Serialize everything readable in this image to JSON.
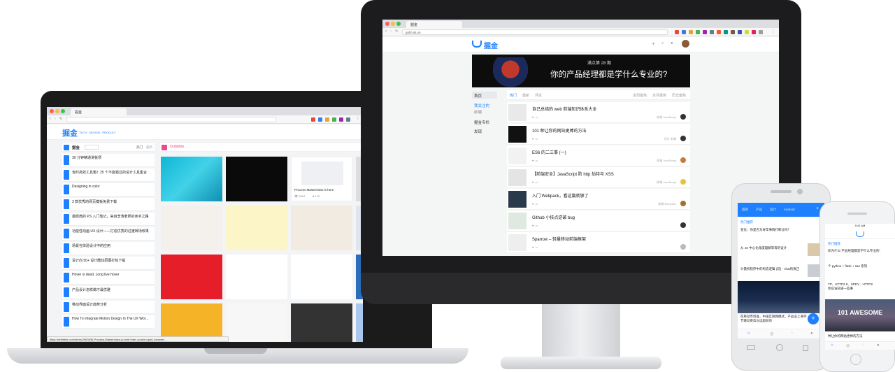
{
  "colors": {
    "accent": "#1e80ff",
    "dribbble": "#ea4c89",
    "dark": "#1c1c1e"
  },
  "laptop": {
    "tab_title": "掘金",
    "url": "",
    "status_bar_url": "https://dribbble.com/shots/2963836-Process-Masterclass-is-here?utm_source=gold_browser...",
    "brand": "掘金",
    "tagline": "TECH · DESIGN · PRODUCT",
    "left_panel": {
      "title": "掘金",
      "filter": "",
      "tabs": [
        "热门",
        "最新"
      ],
      "items": [
        {
          "title": "30 分钟精通滑板项",
          "meta": ""
        },
        {
          "title": "省时高效工具箱！25 个不能错过的设计工具集合",
          "meta": ""
        },
        {
          "title": "Designing in color",
          "meta": ""
        },
        {
          "title": "3 款优秀的网页模板免费下载",
          "meta": ""
        },
        {
          "title": "最经典的 PS 入门笔记，来自李涛老师的亲手之路",
          "meta": ""
        },
        {
          "title": "功能性动画 UX 设计——打造优秀的过渡转场效果",
          "meta": ""
        },
        {
          "title": "场景在体验设计中的应用",
          "meta": ""
        },
        {
          "title": "设计向 50+ 设计酷炫原图打包下载",
          "meta": ""
        },
        {
          "title": "Hover is dead. Long live hover",
          "meta": ""
        },
        {
          "title": "产品设计怎样做才最优雅",
          "meta": ""
        },
        {
          "title": "移动界面设计趋势分析",
          "meta": ""
        },
        {
          "title": "How To Integrate Motion Design In The UX Wor...",
          "meta": ""
        }
      ]
    },
    "right_panel": {
      "title": "Dribbble",
      "shot_title": "Process Masterclass is here",
      "shot_views": "2534",
      "shot_likes": "175"
    }
  },
  "monitor": {
    "url": "gold.xitu.io",
    "brand": "掘金",
    "banner": {
      "small": "满点第 28 期",
      "headline": "你的产品经理都是学什么专业的?"
    },
    "sidebar": [
      "首页",
      "我关注的",
      "前端",
      "掘金专栏",
      "发现"
    ],
    "feed_tabs": [
      "热门",
      "最新",
      "评论"
    ],
    "feed_tabs_right": [
      "本周最热",
      "本月最热",
      "历史最热"
    ],
    "articles": [
      {
        "title": "自己总结的 web 前端知识体系大全",
        "time": "",
        "likes": "",
        "comments": "",
        "tags": "前端  JavaScript"
      },
      {
        "title": "101 种让你的网站更棒的方法",
        "time": "",
        "likes": "",
        "comments": "",
        "tags": "设计  前端"
      },
      {
        "title": "ES6 的二三事 (一)",
        "time": "",
        "likes": "",
        "comments": "",
        "tags": "前端  JavaScript"
      },
      {
        "title": "【前端安全】JavaScript 防 http 劫持与 XSS",
        "time": "",
        "likes": "",
        "comments": "",
        "tags": "前端  JavaScript"
      },
      {
        "title": "入门 Webpack，看这篇就够了",
        "time": "",
        "likes": "",
        "comments": "",
        "tags": "前端  Webpack"
      },
      {
        "title": "Github 小技点逆破 bug",
        "time": "",
        "likes": "",
        "comments": "",
        "tags": ""
      },
      {
        "title": "Sparrow – 轻量移动前端框架",
        "time": "",
        "likes": "",
        "comments": "",
        "tags": ""
      }
    ]
  },
  "phone1": {
    "tabs": [
      "首页",
      "产品",
      "设计",
      "Android"
    ],
    "section": "热门推荐",
    "items": [
      "变化：你是否为寿年事情打断过吗？",
      "从 JS 中心化角度理解等等的设计",
      "计量机程序中的构造逻辑 (前) - chat的真正",
      "在移动市场准，中国互联网模式，产品业上海字节跳动更高与远超前的"
    ]
  },
  "phone2": {
    "time": "9:41 AM",
    "section": "热门推荐",
    "items": [
      "你为什么“产品经理都是学什么专业的”",
      "个 python + flask + sae 系列",
      "TP、HTTP2.0、SPDY、HTTPS\n你应该知道一些事"
    ],
    "hero": "101 AWESOME",
    "caption": "种让你的网站更棒的方法"
  }
}
